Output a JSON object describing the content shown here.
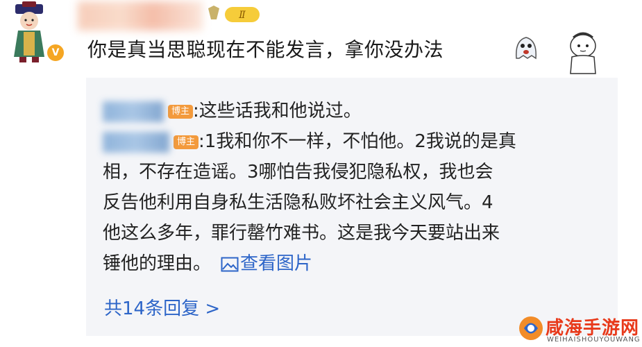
{
  "comment": {
    "text": "你是真当思聪现在不能发言，拿你没办法",
    "level_badge": "Ⅱ",
    "verified": "V"
  },
  "replies": {
    "owner_tag": "博主",
    "items": [
      {
        "text": ":这些话我和他说过。"
      },
      {
        "lines": [
          ":1我和你不一样，不怕他。2我说的是真",
          "相，不存在造谣。3哪怕告我侵犯隐私权，我也会",
          "反告他利用自身私生活隐私败坏社会主义风气。4",
          "他这么多年，罪行罄竹难书。这是我今天要站出来",
          "锤他的理由。"
        ],
        "view_image": "查看图片"
      }
    ],
    "more_label": "共14条回复 >"
  },
  "watermark": {
    "title": "咸海手游网",
    "subtitle": "WEIHAISHOUYOUWANG"
  },
  "colors": {
    "link": "#2d65c8",
    "owner_tag": "#f39a3c",
    "reply_bg": "#f4f5f8"
  }
}
